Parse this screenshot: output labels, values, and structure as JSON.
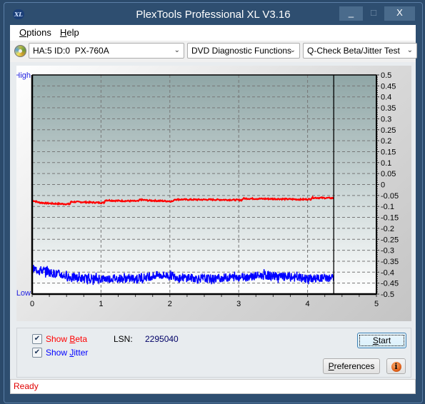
{
  "window": {
    "title": "PlexTools Professional XL V3.16",
    "icon": "xl-app-icon",
    "controls": {
      "minimize": "_",
      "maximize": "□",
      "close": "X"
    }
  },
  "menu": {
    "items": [
      {
        "label": "Options",
        "accel": "O"
      },
      {
        "label": "Help",
        "accel": "H"
      }
    ]
  },
  "toolbar": {
    "drive_icon": "disc-icon",
    "drive_select": "HA:5 ID:0  PX-760A",
    "function_select": "DVD Diagnostic Functions",
    "test_select": "Q-Check Beta/Jitter Test"
  },
  "chart_data": {
    "type": "line",
    "title": "",
    "left_labels": {
      "high": "High",
      "low": "Low"
    },
    "xlabel": "",
    "ylabel": "",
    "xlim": [
      0,
      5
    ],
    "ylim": [
      -0.5,
      0.5
    ],
    "x_ticks": [
      0,
      1,
      2,
      3,
      4,
      5
    ],
    "y_ticks": [
      0.5,
      0.45,
      0.4,
      0.35,
      0.3,
      0.25,
      0.2,
      0.15,
      0.1,
      0.05,
      0,
      -0.05,
      -0.1,
      -0.15,
      -0.2,
      -0.25,
      -0.3,
      -0.35,
      -0.4,
      -0.45,
      -0.5
    ],
    "grid": true,
    "cursor_x": 4.38,
    "series": [
      {
        "name": "Beta",
        "color": "#ff0000",
        "x": [
          0,
          0.1,
          0.2,
          0.3,
          0.4,
          0.5,
          0.55,
          0.56,
          0.7,
          0.9,
          1.0,
          1.05,
          1.06,
          1.2,
          1.4,
          1.55,
          1.56,
          1.7,
          1.9,
          2.05,
          2.06,
          2.3,
          2.6,
          2.9,
          3.05,
          3.06,
          3.3,
          3.6,
          3.9,
          4.05,
          4.06,
          4.2,
          4.38
        ],
        "y": [
          -0.072,
          -0.082,
          -0.085,
          -0.087,
          -0.088,
          -0.089,
          -0.09,
          -0.079,
          -0.08,
          -0.082,
          -0.083,
          -0.083,
          -0.071,
          -0.074,
          -0.075,
          -0.076,
          -0.069,
          -0.073,
          -0.075,
          -0.077,
          -0.068,
          -0.069,
          -0.069,
          -0.07,
          -0.071,
          -0.064,
          -0.065,
          -0.066,
          -0.068,
          -0.067,
          -0.06,
          -0.061,
          -0.062
        ]
      },
      {
        "name": "Jitter",
        "color": "#0000ff",
        "x": [
          0,
          0.1,
          0.2,
          0.3,
          0.4,
          0.5,
          0.6,
          0.8,
          1.0,
          1.2,
          1.4,
          1.6,
          1.8,
          2.0,
          2.2,
          2.4,
          2.6,
          2.8,
          3.0,
          3.2,
          3.4,
          3.6,
          3.8,
          4.0,
          4.2,
          4.38
        ],
        "y": [
          -0.385,
          -0.39,
          -0.395,
          -0.405,
          -0.41,
          -0.42,
          -0.425,
          -0.43,
          -0.43,
          -0.428,
          -0.43,
          -0.425,
          -0.415,
          -0.415,
          -0.425,
          -0.428,
          -0.43,
          -0.425,
          -0.422,
          -0.418,
          -0.415,
          -0.42,
          -0.425,
          -0.43,
          -0.428,
          -0.425
        ],
        "noise_amplitude": 0.02
      }
    ]
  },
  "controls": {
    "show_beta": {
      "label_pre": "Show ",
      "accel": "B",
      "label_post": "eta",
      "checked": true,
      "color": "#ff0000"
    },
    "show_jitter": {
      "label_pre": "Show ",
      "accel": "J",
      "label_post": "itter",
      "checked": true,
      "color": "#0000ff"
    },
    "lsn_label": "LSN:",
    "lsn_value": "2295040",
    "start_button": {
      "accel": "S",
      "rest": "tart"
    },
    "preferences_button": {
      "accel": "P",
      "rest": "references"
    },
    "info_button": "i"
  },
  "status": {
    "text": "Ready"
  }
}
